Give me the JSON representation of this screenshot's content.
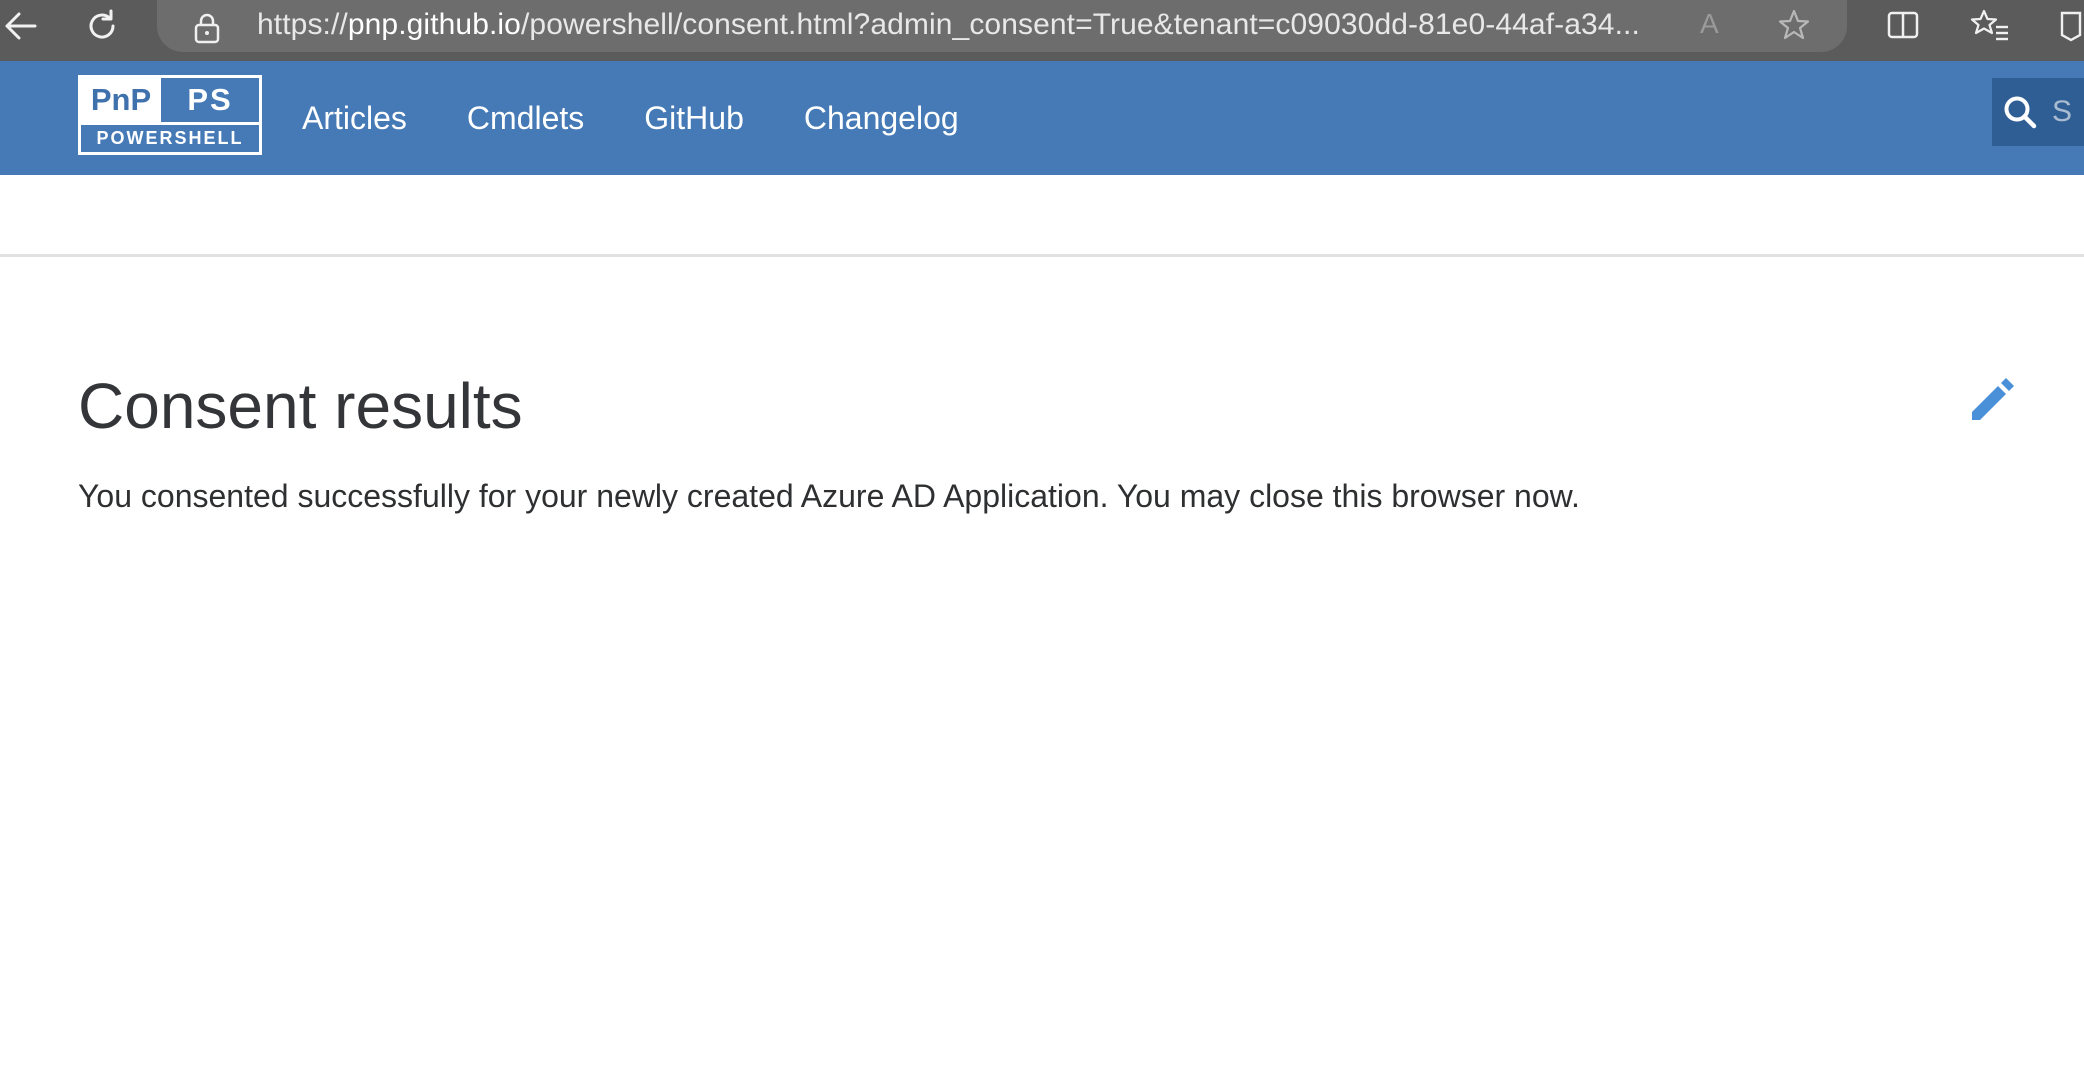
{
  "browser": {
    "url_scheme": "https://",
    "url_host": "pnp.github.io",
    "url_rest": "/powershell/consent.html?admin_consent=True&tenant=c09030dd-81e0-44af-a34...",
    "read_aloud_glyph": "A",
    "icons": [
      "back-arrow-icon",
      "reload-icon",
      "lock-icon",
      "read-aloud-icon",
      "favorite-star-icon",
      "split-screen-icon",
      "favorites-icon",
      "extension-icon"
    ]
  },
  "header": {
    "logo": {
      "top_left": "PnP",
      "top_right": "PS",
      "bottom": "POWERSHELL"
    },
    "nav": [
      "Articles",
      "Cmdlets",
      "GitHub",
      "Changelog"
    ],
    "search_placeholder": "S",
    "colors": {
      "header_bg": "#457ab6",
      "search_bg": "#2f5e95",
      "edit_icon": "#4a90d9"
    }
  },
  "main": {
    "title": "Consent results",
    "text": "You consented successfully for your newly created Azure AD Application. You may close this browser now.",
    "edit_icon": "pencil-icon"
  }
}
